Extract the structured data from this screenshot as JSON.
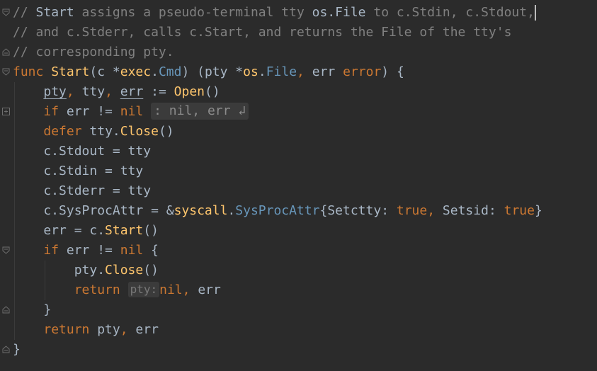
{
  "editor": {
    "language": "Go",
    "colors": {
      "background": "#2b2b2b",
      "text": "#a9b7c6",
      "keyword": "#cc7832",
      "function": "#ffc66d",
      "type": "#6897bb",
      "comment": "#808080",
      "inlay_hint_bg": "#3b3b3b"
    },
    "lines": [
      {
        "tokens": [
          {
            "t": "// ",
            "c": "cm"
          },
          {
            "t": "Start",
            "c": "cmk"
          },
          {
            "t": " assigns a pseudo-terminal tty ",
            "c": "cm"
          },
          {
            "t": "os.File",
            "c": "cmk"
          },
          {
            "t": " to c.Stdin, c.Stdout,",
            "c": "cm"
          }
        ]
      },
      {
        "tokens": [
          {
            "t": "// and c.Stderr, calls c.Start, and returns the File of the tty's",
            "c": "cm"
          }
        ]
      },
      {
        "tokens": [
          {
            "t": "// corresponding pty.",
            "c": "cm"
          }
        ]
      },
      {
        "tokens": [
          {
            "t": "func ",
            "c": "kw"
          },
          {
            "t": "Start",
            "c": "fn"
          },
          {
            "t": "(c *"
          },
          {
            "t": "exec",
            "c": "fn"
          },
          {
            "t": "."
          },
          {
            "t": "Cmd",
            "c": "ty"
          },
          {
            "t": ") (pty *"
          },
          {
            "t": "os",
            "c": "fn"
          },
          {
            "t": "."
          },
          {
            "t": "File",
            "c": "ty"
          },
          {
            "t": ", ",
            "c": "kw"
          },
          {
            "t": "err "
          },
          {
            "t": "error",
            "c": "kw"
          },
          {
            "t": ") {"
          }
        ]
      },
      {
        "tokens": [
          {
            "t": "    "
          },
          {
            "t": "pty",
            "c": "ul"
          },
          {
            "t": ", ",
            "c": "kw"
          },
          {
            "t": "tty"
          },
          {
            "t": ", ",
            "c": "kw"
          },
          {
            "t": "err",
            "c": "ul"
          },
          {
            "t": " := "
          },
          {
            "t": "Open",
            "c": "fn"
          },
          {
            "t": "()"
          }
        ]
      },
      {
        "tokens": [
          {
            "t": "    "
          },
          {
            "t": "if ",
            "c": "kw"
          },
          {
            "t": "err != "
          },
          {
            "t": "nil",
            "c": "kw"
          },
          {
            "t": " "
          },
          {
            "t": ": nil, err ↲",
            "c": "fold"
          }
        ]
      },
      {
        "tokens": [
          {
            "t": "    "
          },
          {
            "t": "defer ",
            "c": "kw"
          },
          {
            "t": "tty."
          },
          {
            "t": "Close",
            "c": "fn"
          },
          {
            "t": "()"
          }
        ]
      },
      {
        "tokens": [
          {
            "t": "    c.Stdout = tty"
          }
        ]
      },
      {
        "tokens": [
          {
            "t": "    c.Stdin = tty"
          }
        ]
      },
      {
        "tokens": [
          {
            "t": "    c.Stderr = tty"
          }
        ]
      },
      {
        "tokens": [
          {
            "t": "    c.SysProcAttr = &"
          },
          {
            "t": "syscall",
            "c": "fn"
          },
          {
            "t": "."
          },
          {
            "t": "SysProcAttr",
            "c": "ty"
          },
          {
            "t": "{Setctty: "
          },
          {
            "t": "true",
            "c": "kw"
          },
          {
            "t": ", ",
            "c": "kw"
          },
          {
            "t": "Setsid: "
          },
          {
            "t": "true",
            "c": "kw"
          },
          {
            "t": "}"
          }
        ]
      },
      {
        "tokens": [
          {
            "t": "    err = c."
          },
          {
            "t": "Start",
            "c": "fn"
          },
          {
            "t": "()"
          }
        ]
      },
      {
        "tokens": [
          {
            "t": "    "
          },
          {
            "t": "if ",
            "c": "kw"
          },
          {
            "t": "err != "
          },
          {
            "t": "nil",
            "c": "kw"
          },
          {
            "t": " {"
          }
        ]
      },
      {
        "tokens": [
          {
            "t": "        pty."
          },
          {
            "t": "Close",
            "c": "fn"
          },
          {
            "t": "()"
          }
        ]
      },
      {
        "tokens": [
          {
            "t": "        "
          },
          {
            "t": "return",
            "c": "kw"
          },
          {
            "t": " "
          },
          {
            "t": "pty:",
            "c": "inlay"
          },
          {
            "t": "nil",
            "c": "kw"
          },
          {
            "t": ", ",
            "c": "kw"
          },
          {
            "t": "err"
          }
        ]
      },
      {
        "tokens": [
          {
            "t": "    }"
          }
        ]
      },
      {
        "tokens": [
          {
            "t": "    "
          },
          {
            "t": "return ",
            "c": "kw"
          },
          {
            "t": "pty"
          },
          {
            "t": ", ",
            "c": "kw"
          },
          {
            "t": "err"
          }
        ]
      },
      {
        "tokens": [
          {
            "t": "}"
          }
        ]
      }
    ],
    "gutter_markers": [
      {
        "line": 0,
        "kind": "fold-start"
      },
      {
        "line": 2,
        "kind": "fold-end"
      },
      {
        "line": 3,
        "kind": "fold-start"
      },
      {
        "line": 5,
        "kind": "fold-collapsed"
      },
      {
        "line": 12,
        "kind": "fold-start"
      },
      {
        "line": 15,
        "kind": "fold-end"
      },
      {
        "line": 17,
        "kind": "fold-end"
      }
    ],
    "caret": {
      "line": 0,
      "column": 68
    }
  }
}
